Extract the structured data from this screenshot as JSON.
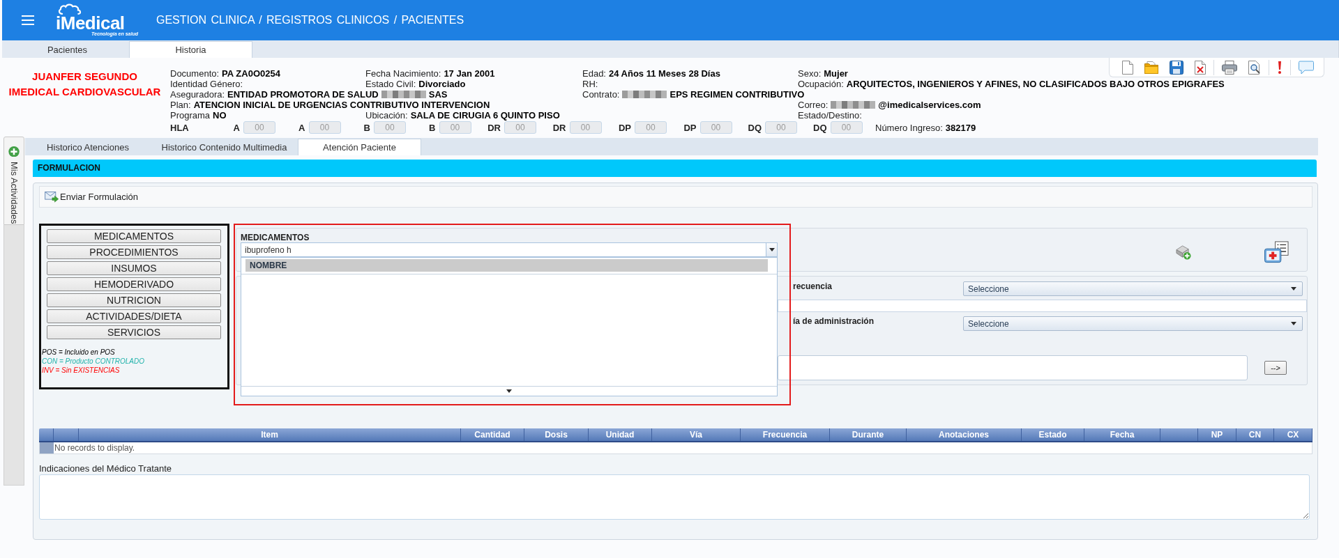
{
  "header": {
    "logo": {
      "name": "iMedical",
      "tagline": "Tecnología en salud"
    },
    "breadcrumb": "GESTION CLINICA / REGISTROS CLINICOS / PACIENTES"
  },
  "tabs": [
    {
      "label": "Pacientes",
      "selected": false
    },
    {
      "label": "Historia",
      "selected": true
    }
  ],
  "patient": {
    "banner": [
      "JUANFER SEGUNDO",
      "IMEDICAL CARDIOVASCULAR"
    ],
    "rows": [
      [
        {
          "label": "Documento:",
          "value": "PA ZA0O0254"
        },
        {
          "label": "Fecha Nacimiento:",
          "value": "17 Jan 2001"
        },
        {
          "label": "Edad:",
          "value": "24 Años 11 Meses 28 Días"
        },
        {
          "label": "Sexo:",
          "value": "Mujer"
        }
      ],
      [
        {
          "label": "Identidad Género:"
        },
        {
          "label": "Estado Civil:",
          "value": "Divorciado"
        },
        {
          "label": "RH:"
        },
        {
          "label": "Ocupación:",
          "value": "ARQUITECTOS, INGENIEROS Y AFINES, NO CLASIFICADOS BAJO OTROS EPIGRAFES"
        }
      ],
      [
        {
          "label": "Aseguradora:",
          "value": "ENTIDAD PROMOTORA DE SALUD",
          "redacted": true,
          "value_after": "SAS"
        },
        null,
        {
          "label": "Contrato:",
          "redacted": true,
          "value_after": "EPS REGIMEN CONTRIBUTIVO"
        }
      ],
      [
        {
          "label": "Plan:",
          "value": "ATENCION INICIAL DE URGENCIAS CONTRIBUTIVO INTERVENCION"
        },
        null,
        null,
        {
          "label": "Correo:",
          "redacted": true,
          "value_after": "@imedicalservices.com"
        }
      ],
      [
        {
          "label": "Programa",
          "value": "NO"
        },
        {
          "label": "Ubicación:",
          "value": "SALA DE CIRUGIA 6 QUINTO PISO"
        },
        null,
        {
          "label": "Estado/Destino:"
        }
      ]
    ],
    "hla": {
      "label": "HLA",
      "fields": [
        {
          "label": "A",
          "value": "00",
          "disabled": true
        },
        {
          "label": "A",
          "value": "00",
          "disabled": true
        },
        {
          "label": "B",
          "value": "00",
          "disabled": true
        },
        {
          "label": "B",
          "value": "00",
          "disabled": true
        },
        {
          "label": "DR",
          "value": "00",
          "disabled": true
        },
        {
          "label": "DR",
          "value": "00",
          "disabled": true
        },
        {
          "label": "DP",
          "value": "00",
          "disabled": true
        },
        {
          "label": "DP",
          "value": "00",
          "disabled": true
        },
        {
          "label": "DQ",
          "value": "00",
          "disabled": true
        },
        {
          "label": "DQ",
          "value": "00",
          "disabled": true
        }
      ]
    },
    "admission": {
      "label": "Número Ingreso:",
      "value": "382179"
    }
  },
  "side_tab": {
    "label": "Mis Actividades"
  },
  "subtabs": [
    {
      "label": "Historico Atenciones",
      "selected": false
    },
    {
      "label": "Historico Contenido Multimedia",
      "selected": false
    },
    {
      "label": "Atención Paciente",
      "selected": true
    }
  ],
  "section": {
    "title": "FORMULACION",
    "action": "Enviar Formulación"
  },
  "categories": [
    "MEDICAMENTOS",
    "PROCEDIMIENTOS",
    "INSUMOS",
    "HEMODERIVADO",
    "NUTRICION",
    "ACTIVIDADES/DIETA",
    "SERVICIOS"
  ],
  "legend": [
    {
      "text": "POS = Incluido en POS",
      "color": "#000000"
    },
    {
      "text": "CON = Producto CONTROLADO",
      "color": "#20b2aa"
    },
    {
      "text": "INV = Sin EXISTENCIAS",
      "color": "#ff0000"
    }
  ],
  "medication_search": {
    "label": "MEDICAMENTOS",
    "value": "ibuprofeno h",
    "list_header": "NOMBRE"
  },
  "form": {
    "rows": [
      {
        "kind": "select",
        "label": "recuencia",
        "value": "Seleccione"
      },
      {
        "kind": "input"
      },
      {
        "kind": "select",
        "label": "ía de administración",
        "value": "Seleccione"
      },
      {
        "kind": "input_action",
        "action": "-->"
      }
    ]
  },
  "table": {
    "columns": [
      {
        "kind": "selector"
      },
      {
        "kind": "blank"
      },
      {
        "kind": "text",
        "label": "Item"
      },
      {
        "kind": "text",
        "label": "Cantidad"
      },
      {
        "kind": "text",
        "label": "Dosis"
      },
      {
        "kind": "text",
        "label": "Unidad"
      },
      {
        "kind": "text",
        "label": "Vía"
      },
      {
        "kind": "text",
        "label": "Frecuencia"
      },
      {
        "kind": "text",
        "label": "Durante"
      },
      {
        "kind": "text",
        "label": "Anotaciones"
      },
      {
        "kind": "text",
        "label": "Estado"
      },
      {
        "kind": "text",
        "label": "Fecha"
      },
      {
        "kind": "blank"
      },
      {
        "kind": "text",
        "label": "NP"
      },
      {
        "kind": "text",
        "label": "CN"
      },
      {
        "kind": "text",
        "label": "CX"
      }
    ],
    "empty_message": "No records to display."
  },
  "notes": {
    "label": "Indicaciones del Médico Tratante"
  }
}
